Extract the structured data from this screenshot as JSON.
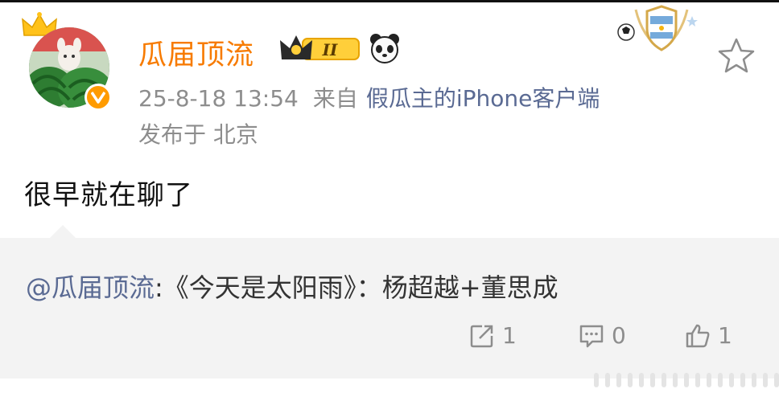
{
  "post": {
    "username": "瓜届顶流",
    "level_badge": "II",
    "time": "25-8-18 13:54",
    "source_label": "来自",
    "source": "假瓜主的iPhone客户端",
    "location": "发布于 北京",
    "text": "很早就在聊了"
  },
  "quote": {
    "mention": "@瓜届顶流",
    "body": ":《今天是太阳雨》：杨超越+董思成"
  },
  "actions": {
    "share_count": "1",
    "comment_count": "0",
    "like_count": "1"
  },
  "icons": {
    "avatar": "watermelon-avatar",
    "verified": "vip-v-icon",
    "level": "crown-level-icon",
    "panda": "panda-icon",
    "honor": "argentina-shield-icon",
    "favorite": "star-icon",
    "share": "share-icon",
    "comment": "comment-icon",
    "like": "thumbs-up-icon"
  },
  "colors": {
    "username": "#f77b00",
    "link": "#5a6a93",
    "meta": "#8d8d8d",
    "quote_bg": "#f3f3f3"
  }
}
